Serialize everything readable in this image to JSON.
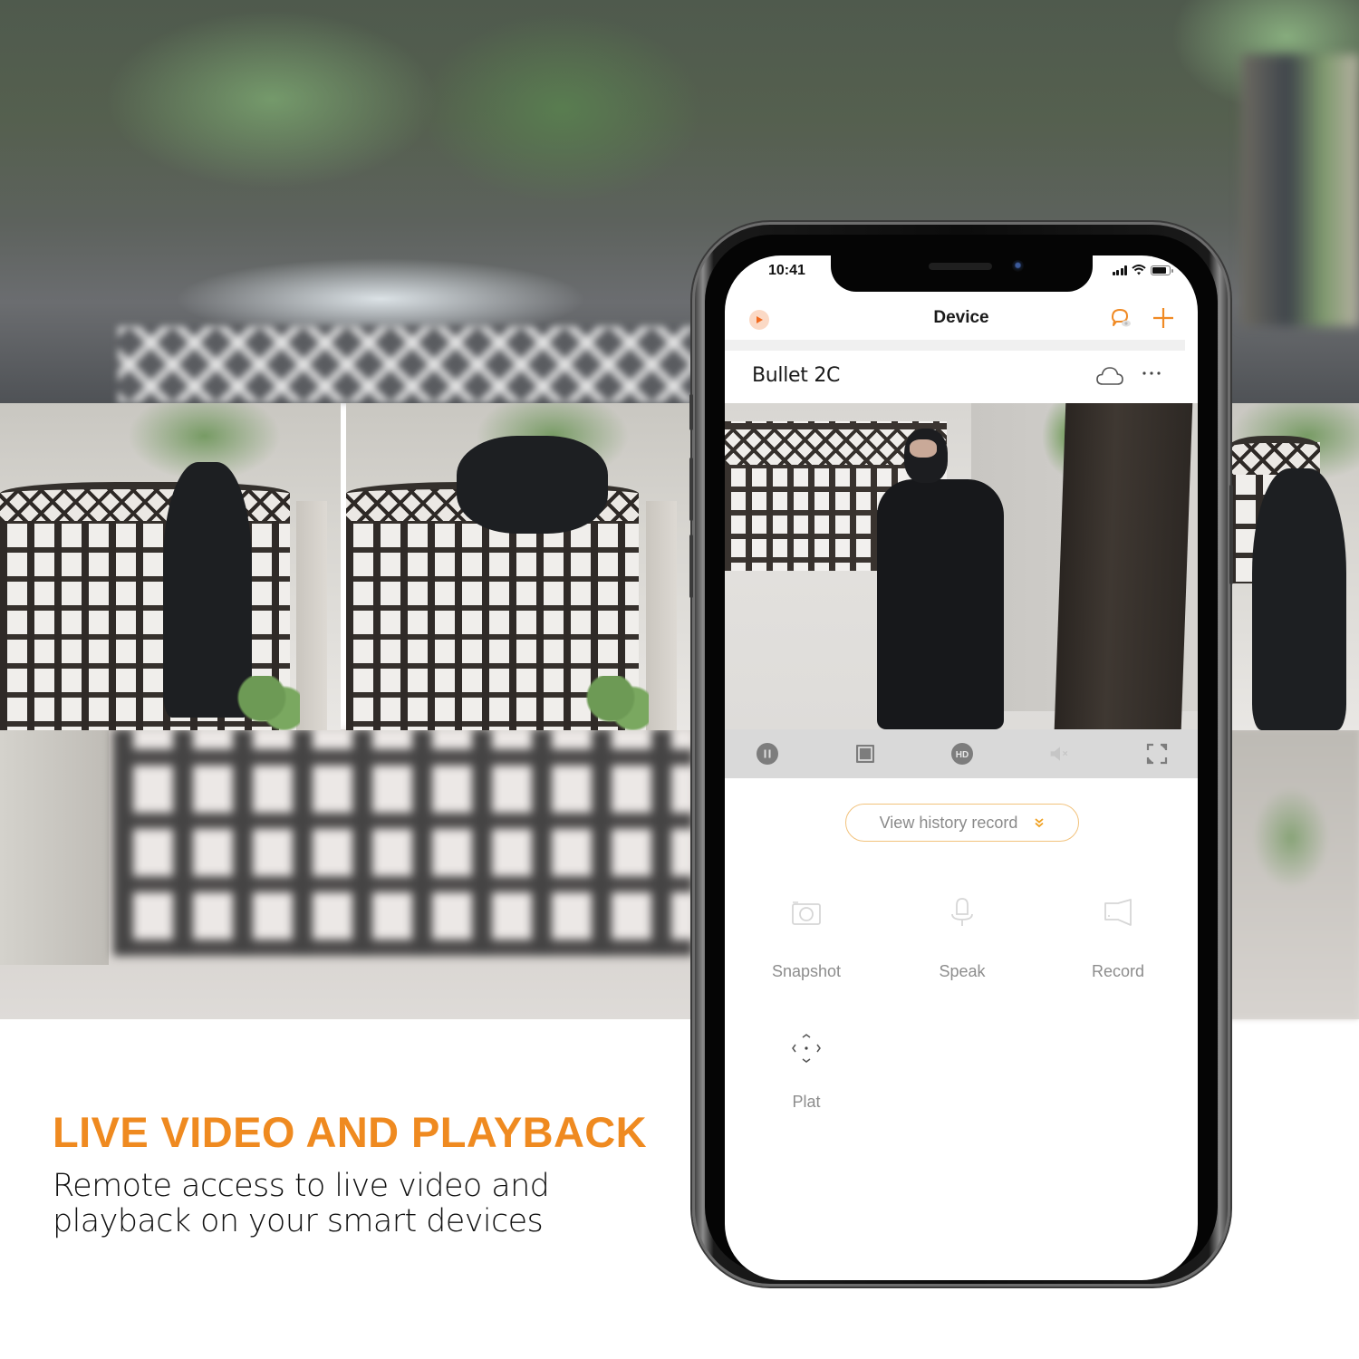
{
  "marketing": {
    "headline": "LIVE VIDEO AND PLAYBACK",
    "subcopy": "Remote access to live video and playback on your smart devices",
    "accent_color": "#EF8A20"
  },
  "photos": [
    {
      "description": "masked intruder leaning over wooden gate"
    },
    {
      "description": "masked intruder climbing over wooden gate"
    },
    {
      "description": "masked intruder crouching near gate"
    }
  ],
  "phone": {
    "status_bar": {
      "time": "10:41",
      "icons": [
        "signal-icon",
        "wifi-icon",
        "battery-icon"
      ]
    },
    "nav": {
      "title": "Device",
      "left_icon": "play-icon",
      "right_icons": [
        "message-icon",
        "add-icon"
      ]
    },
    "device": {
      "name": "Bullet 2C",
      "icons": [
        "cloud-icon",
        "more-icon"
      ]
    },
    "live_view": {
      "description": "live camera feed of masked man in courtyard"
    },
    "controls": [
      {
        "name": "pause",
        "icon": "pause-icon"
      },
      {
        "name": "stop",
        "icon": "stop-icon"
      },
      {
        "name": "hd",
        "icon": "hd-icon",
        "label": "HD"
      },
      {
        "name": "mute",
        "icon": "mute-icon"
      },
      {
        "name": "fullscreen",
        "icon": "fullscreen-icon"
      }
    ],
    "history_button": {
      "label": "View history record",
      "icon": "double-chevron-down-icon",
      "border_color": "#F2C27C"
    },
    "features": [
      {
        "label": "Snapshot",
        "icon": "camera-icon"
      },
      {
        "label": "Speak",
        "icon": "microphone-icon"
      },
      {
        "label": "Record",
        "icon": "video-record-icon"
      },
      {
        "label": "Plat",
        "icon": "pan-tilt-icon"
      }
    ],
    "accent_color": "#F08A24"
  }
}
